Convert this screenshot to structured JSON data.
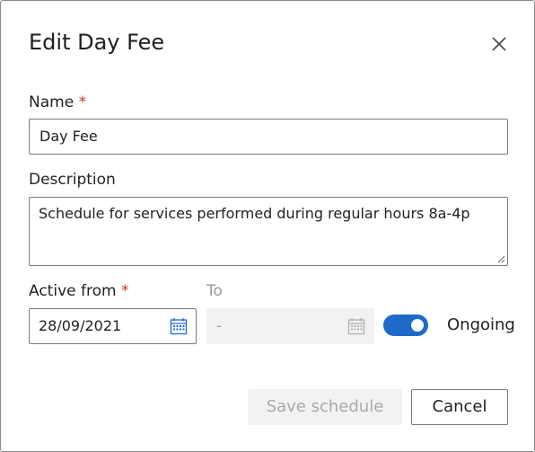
{
  "dialog": {
    "title": "Edit Day Fee",
    "close_icon": "close-icon"
  },
  "form": {
    "name_label": "Name",
    "required_marker": "*",
    "name_value": "Day Fee",
    "description_label": "Description",
    "description_value": "Schedule for services performed during regular hours 8a-4p",
    "active_from_label": "Active from",
    "active_from_value": "28/09/2021",
    "to_label": "To",
    "to_value": "-",
    "calendar_icon": "calendar-icon",
    "ongoing_label": "Ongoing",
    "ongoing_enabled": true
  },
  "buttons": {
    "save_label": "Save schedule",
    "cancel_label": "Cancel"
  },
  "colors": {
    "accent": "#1e6ac9",
    "required": "#c0392b",
    "disabled_text": "#9a9a9a",
    "disabled_bg": "#f2f2f2"
  }
}
